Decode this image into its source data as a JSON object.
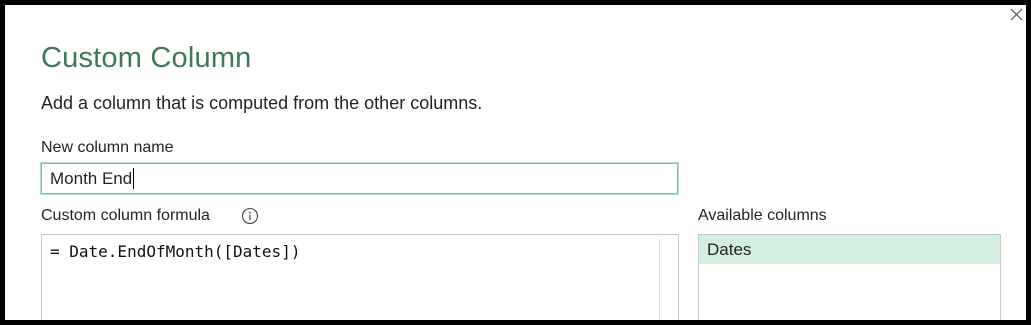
{
  "dialog": {
    "title": "Custom Column",
    "subtitle": "Add a column that is computed from the other columns.",
    "close_icon": "close-icon"
  },
  "new_column_name": {
    "label": "New column name",
    "value": "Month End"
  },
  "formula": {
    "label": "Custom column formula",
    "info_icon": "info-icon",
    "value": "= Date.EndOfMonth([Dates])"
  },
  "available_columns": {
    "label": "Available columns",
    "items": [
      "Dates"
    ]
  },
  "colors": {
    "title_green": "#3b7a57",
    "input_border_green": "#7fc1a0",
    "selected_item_bg": "#d4eee0"
  }
}
